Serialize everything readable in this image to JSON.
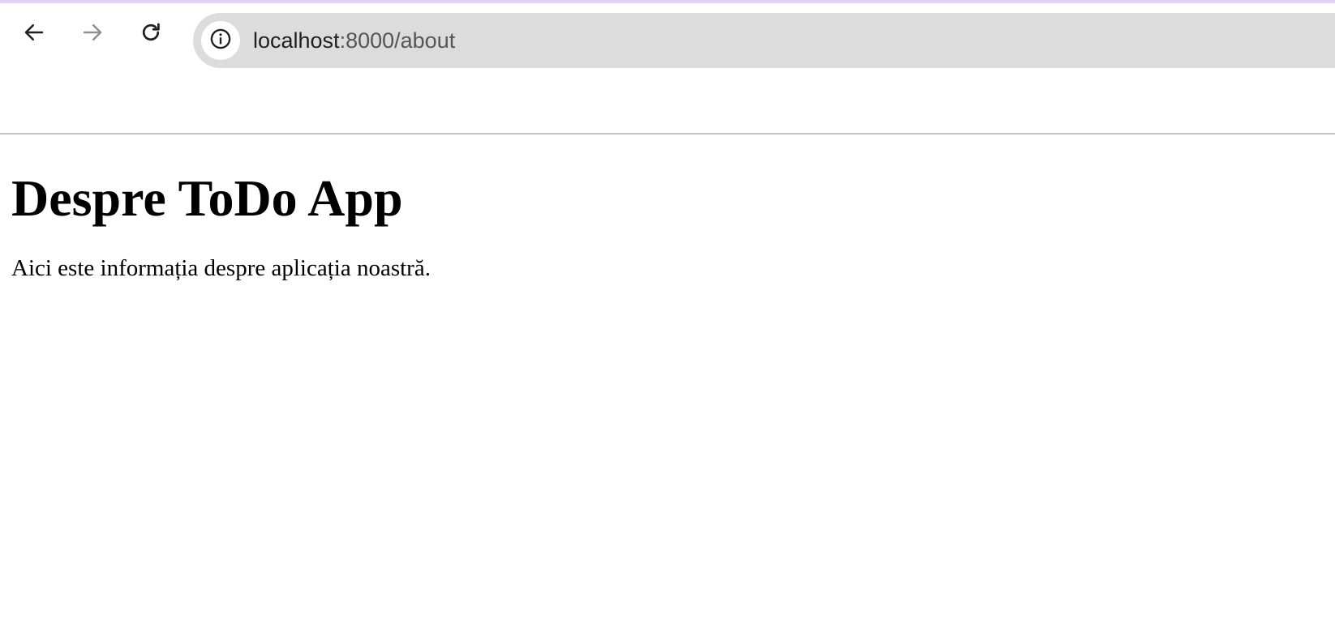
{
  "browser": {
    "url_host": "localhost",
    "url_rest": ":8000/about",
    "icons": {
      "back": "back-arrow-icon",
      "forward": "forward-arrow-icon",
      "reload": "reload-icon",
      "site_info": "info-icon"
    },
    "forward_disabled": true
  },
  "page": {
    "title": "Despre ToDo App",
    "text": "Aici este informația despre aplicația noastră."
  },
  "colors": {
    "top_strip": "#e4d0f7",
    "omnibox": "#dcdcdc",
    "divider": "#c4c4c4"
  }
}
